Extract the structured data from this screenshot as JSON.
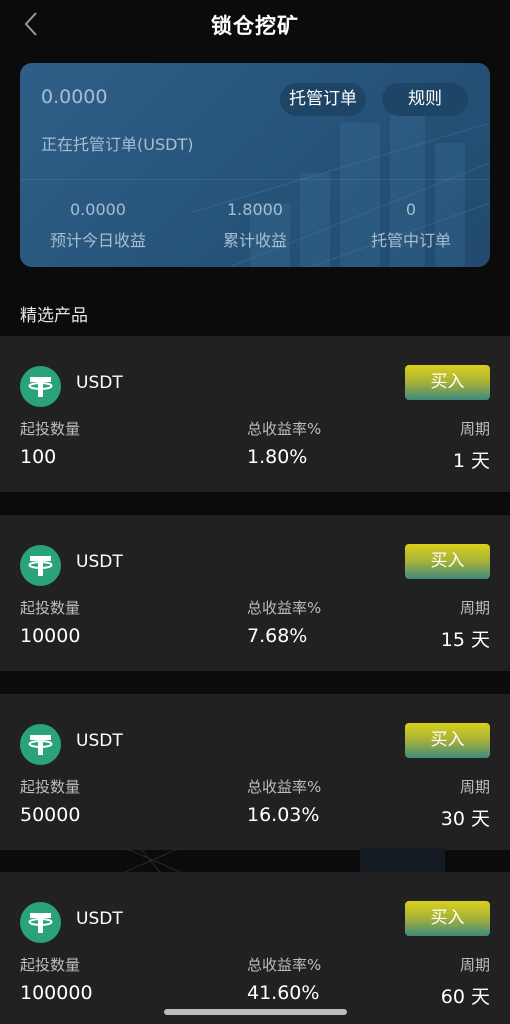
{
  "header": {
    "title": "锁仓挖矿"
  },
  "summary": {
    "total": "0.0000",
    "orders_button": "托管订单",
    "rules_button": "规则",
    "subtitle": "正在托管订单(USDT)",
    "stats": [
      {
        "value": "0.0000",
        "label": "预计今日收益"
      },
      {
        "value": "1.8000",
        "label": "累计收益"
      },
      {
        "value": "0",
        "label": "托管中订单"
      }
    ]
  },
  "section_title": "精选产品",
  "products": [
    {
      "coin": "USDT",
      "buy_label": "买入",
      "min_label": "起投数量",
      "min_value": "100",
      "rate_label": "总收益率%",
      "rate_value": "1.80%",
      "period_label": "周期",
      "period_value": "1 天"
    },
    {
      "coin": "USDT",
      "buy_label": "买入",
      "min_label": "起投数量",
      "min_value": "10000",
      "rate_label": "总收益率%",
      "rate_value": "7.68%",
      "period_label": "周期",
      "period_value": "15 天"
    },
    {
      "coin": "USDT",
      "buy_label": "买入",
      "min_label": "起投数量",
      "min_value": "50000",
      "rate_label": "总收益率%",
      "rate_value": "16.03%",
      "period_label": "周期",
      "period_value": "30 天"
    },
    {
      "coin": "USDT",
      "buy_label": "买入",
      "min_label": "起投数量",
      "min_value": "100000",
      "rate_label": "总收益率%",
      "rate_value": "41.60%",
      "period_label": "周期",
      "period_value": "60 天"
    }
  ],
  "colors": {
    "background": "#0b0b0b",
    "card": "#212121",
    "summary": "#2a5a82",
    "tether": "#2aa27b",
    "buy_top": "#d9d11c",
    "buy_bottom": "#3e8a7e"
  },
  "icons": {
    "back": "chevron-left-icon",
    "coin": "tether-icon"
  }
}
